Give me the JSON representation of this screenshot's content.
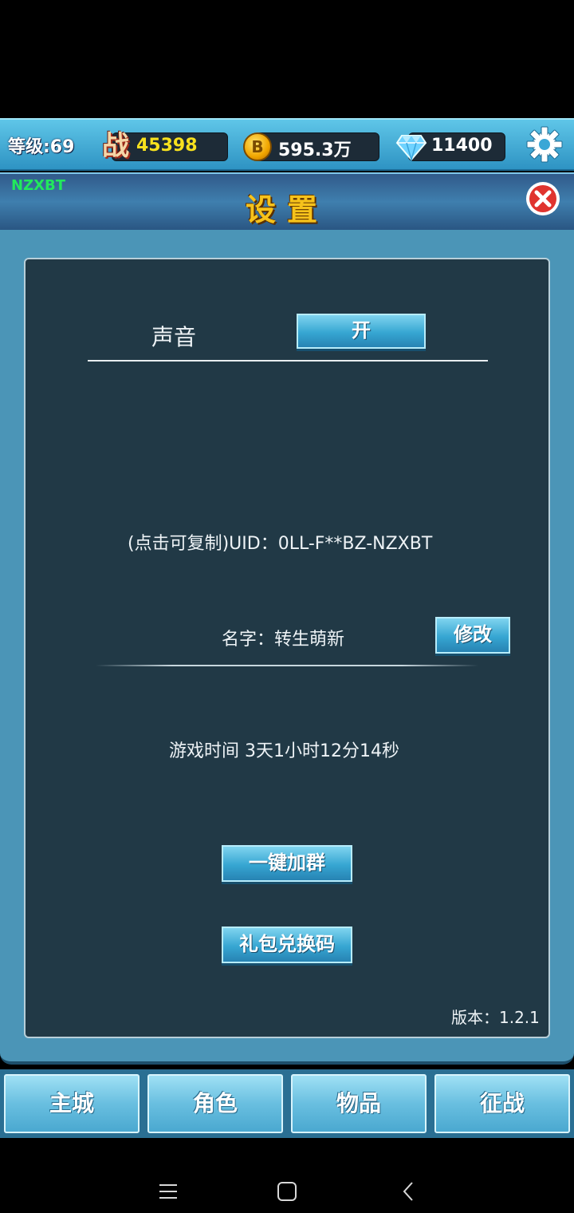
{
  "topbar": {
    "level": "等级:69",
    "power_icon_glyph": "战",
    "power": "45398",
    "coin_icon_glyph": "B",
    "gold": "595.3万",
    "diamonds": "11400"
  },
  "panel": {
    "tag": "NZXBT",
    "title": "设置"
  },
  "settings": {
    "sound_label": "声音",
    "sound_toggle": "开",
    "uid_text": "(点击可复制)UID：0LL-F**BZ-NZXBT",
    "name_text": "名字：转生萌新",
    "rename_button": "修改",
    "play_time": "游戏时间 3天1小时12分14秒",
    "join_group_button": "一键加群",
    "gift_code_button": "礼包兑换码",
    "version": "版本：1.2.1"
  },
  "tabs": [
    "主城",
    "角色",
    "物品",
    "征战"
  ],
  "colors": {
    "title_gold": "#f6c21b",
    "tag_green": "#22e85c",
    "panel_dark": "#213946",
    "button_blue": "#36a6d2"
  }
}
